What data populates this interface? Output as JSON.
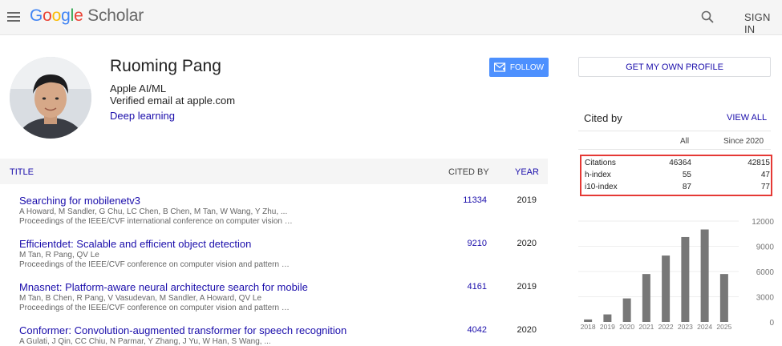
{
  "header": {
    "logo": {
      "g1": "G",
      "o1": "o",
      "o2": "o",
      "g2": "g",
      "l": "l",
      "e": "e",
      "scholar": " Scholar"
    },
    "sign_in": "SIGN IN"
  },
  "profile": {
    "name": "Ruoming Pang",
    "affiliation": "Apple AI/ML",
    "email": "Verified email at apple.com",
    "interest": "Deep learning",
    "follow_label": "FOLLOW"
  },
  "table": {
    "headers": {
      "title": "TITLE",
      "cited_by": "CITED BY",
      "year": "YEAR"
    },
    "rows": [
      {
        "title": "Searching for mobilenetv3",
        "authors": "A Howard, M Sandler, G Chu, LC Chen, B Chen, M Tan, W Wang, Y Zhu, ...",
        "venue": "Proceedings of the IEEE/CVF international conference on computer vision …",
        "cites": "11334",
        "year": "2019"
      },
      {
        "title": "Efficientdet: Scalable and efficient object detection",
        "authors": "M Tan, R Pang, QV Le",
        "venue": "Proceedings of the IEEE/CVF conference on computer vision and pattern …",
        "cites": "9210",
        "year": "2020"
      },
      {
        "title": "Mnasnet: Platform-aware neural architecture search for mobile",
        "authors": "M Tan, B Chen, R Pang, V Vasudevan, M Sandler, A Howard, QV Le",
        "venue": "Proceedings of the IEEE/CVF conference on computer vision and pattern …",
        "cites": "4161",
        "year": "2019"
      },
      {
        "title": "Conformer: Convolution-augmented transformer for speech recognition",
        "authors": "A Gulati, J Qin, CC Chiu, N Parmar, Y Zhang, J Yu, W Han, S Wang, ...",
        "venue": "",
        "cites": "4042",
        "year": "2020"
      }
    ]
  },
  "sidebar": {
    "own_profile": "GET MY OWN PROFILE",
    "cited_by_title": "Cited by",
    "view_all": "VIEW ALL",
    "col_all": "All",
    "col_since": "Since 2020",
    "stats": [
      {
        "label": "Citations",
        "all": "46364",
        "since": "42815"
      },
      {
        "label": "h-index",
        "all": "55",
        "since": "47"
      },
      {
        "label": "i10-index",
        "all": "87",
        "since": "77"
      }
    ]
  },
  "colors": {
    "link": "#1a0dab",
    "bar": "#777777",
    "highlight": "#e53935",
    "follow": "#4d90fe"
  },
  "chart_data": {
    "type": "bar",
    "categories": [
      "2018",
      "2019",
      "2020",
      "2021",
      "2022",
      "2023",
      "2024",
      "2025"
    ],
    "values": [
      300,
      900,
      2800,
      5700,
      7900,
      10100,
      11000,
      5700
    ],
    "ylim": [
      0,
      12000
    ],
    "yticks": [
      "0",
      "3000",
      "6000",
      "9000",
      "12000"
    ],
    "grid": true,
    "axis_side": "right"
  }
}
